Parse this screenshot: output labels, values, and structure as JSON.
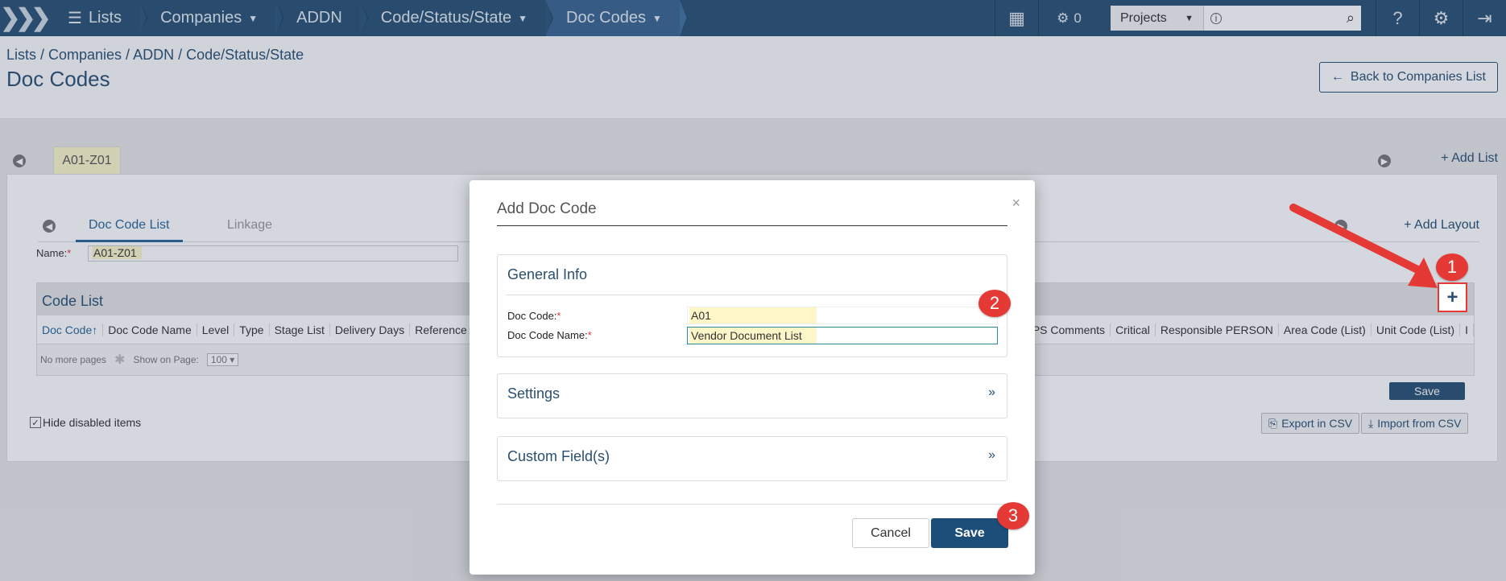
{
  "topbar": {
    "breadcrumbs": [
      "Lists",
      "Companies",
      "ADDN",
      "Code/Status/State",
      "Doc Codes"
    ],
    "notif_count": "0",
    "projects_label": "Projects",
    "search_value": ""
  },
  "header": {
    "path": "Lists / Companies / ADDN / Code/Status/State",
    "title": "Doc Codes",
    "back_label": "Back to Companies List"
  },
  "list_tabs": {
    "active": "A01-Z01",
    "add_list": "Add List"
  },
  "subtabs": {
    "items": [
      "Doc Code List",
      "Linkage"
    ],
    "add_layout": "Add Layout"
  },
  "name_field": {
    "label": "Name:",
    "value": "A01-Z01"
  },
  "code_list": {
    "title": "Code List",
    "columns_left": [
      "Doc Code↑",
      "Doc Code Name",
      "Level",
      "Type",
      "Stage List",
      "Delivery Days",
      "Reference Da"
    ],
    "columns_right": [
      "NPS Comments",
      "Critical",
      "Responsible PERSON",
      "Area Code (List)",
      "Unit Code (List)",
      "I"
    ],
    "no_more_pages": "No more pages",
    "show_on_page_label": "Show on Page:",
    "show_on_page_value": "100"
  },
  "bottom": {
    "save": "Save",
    "hide_disabled": "Hide disabled items",
    "export_csv": "Export in CSV",
    "import_csv": "Import from CSV"
  },
  "modal": {
    "title": "Add Doc Code",
    "close": "×",
    "general_info": "General Info",
    "doc_code_label": "Doc Code:",
    "doc_code_value": "A01",
    "doc_code_name_label": "Doc Code Name:",
    "doc_code_name_value": "Vendor Document List",
    "settings": "Settings",
    "custom_fields": "Custom Field(s)",
    "cancel": "Cancel",
    "save": "Save",
    "chevron": "»"
  },
  "annotations": {
    "badges": [
      "1",
      "2",
      "3"
    ],
    "color": "#e53935"
  },
  "colors": {
    "navbar": "#2a4f72",
    "accent": "#1d4e79",
    "highlight": "#fdf6c8"
  }
}
